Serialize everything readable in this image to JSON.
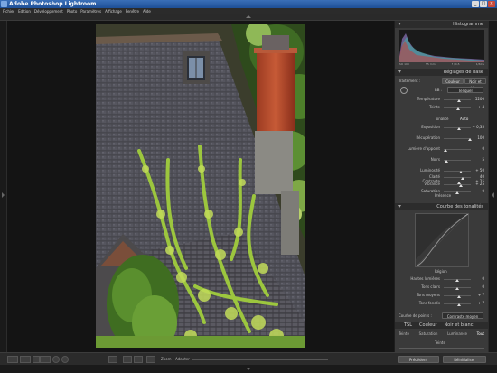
{
  "window": {
    "title": "Adobe Photoshop Lightroom",
    "minimize": "_",
    "maximize": "□",
    "close": "×"
  },
  "menu": [
    "Fichier",
    "Edition",
    "Développement",
    "Photo",
    "Paramètres",
    "Affichage",
    "Fenêtre",
    "Aide"
  ],
  "histogram": {
    "title": "Histogramme",
    "readouts": [
      "ISO 100",
      "55 mm",
      "f / 4,5",
      "1/60 s"
    ]
  },
  "basic": {
    "title": "Réglages de base",
    "treatment_label": "Traitement :",
    "color_label": "Couleur",
    "bw_label": "Noir et blanc",
    "wb_label": "BB :",
    "wb_value": "Tel quel",
    "sliders_top": [
      {
        "label": "Température",
        "value": "5200",
        "pos": 0.55
      },
      {
        "label": "Teinte",
        "value": "+ 4",
        "pos": 0.52
      }
    ],
    "tone_label": "Tonalité",
    "auto_label": "Auto",
    "sliders_tone": [
      {
        "label": "Exposition",
        "value": "+ 0,35",
        "pos": 0.58
      },
      {
        "label": "Récupération",
        "value": "100",
        "pos": 0.98
      },
      {
        "label": "Lumière d'appoint",
        "value": "0",
        "pos": 0.05
      },
      {
        "label": "Noirs",
        "value": "5",
        "pos": 0.1
      },
      {
        "label": "Luminosité",
        "value": "+ 50",
        "pos": 0.62
      },
      {
        "label": "Contraste",
        "value": "+ 25",
        "pos": 0.56
      }
    ],
    "presence_label": "Présence",
    "sliders_presence": [
      {
        "label": "Clarté",
        "value": "40",
        "pos": 0.7
      },
      {
        "label": "Vibrance",
        "value": "+ 25",
        "pos": 0.62
      },
      {
        "label": "Saturation",
        "value": "0",
        "pos": 0.5
      }
    ]
  },
  "tonecurve": {
    "title": "Courbe des tonalités",
    "region_label": "Région",
    "sliders": [
      {
        "label": "Hautes lumières",
        "value": "0",
        "pos": 0.5
      },
      {
        "label": "Tons clairs",
        "value": "0",
        "pos": 0.5
      },
      {
        "label": "Tons moyens",
        "value": "+ 7",
        "pos": 0.56
      },
      {
        "label": "Tons foncés",
        "value": "+ 7",
        "pos": 0.56
      }
    ],
    "point_curve_label": "Courbe de points :",
    "point_curve_value": "Contraste moyen"
  },
  "hsl": {
    "tabs": [
      "TSL",
      "Couleur",
      "Noir et blanc"
    ],
    "sub_tabs": [
      "Teinte",
      "Saturation",
      "Luminance",
      "Tout"
    ],
    "group": "Teinte"
  },
  "footer_buttons": {
    "previous": "Précédent",
    "reset": "Réinitialiser"
  },
  "toolbar": {
    "zoom_label": "Zoom",
    "fit_label": "Adapter"
  }
}
